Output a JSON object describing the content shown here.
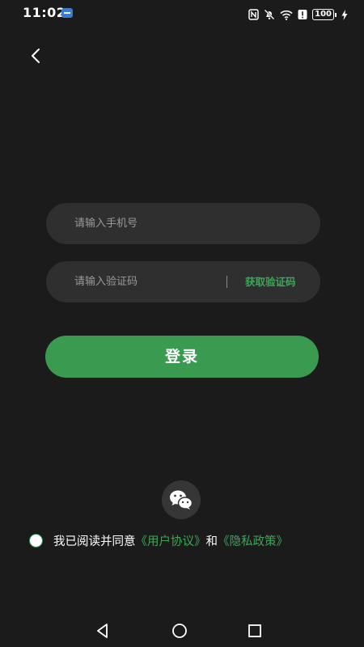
{
  "status": {
    "time": "11:02",
    "battery": "100"
  },
  "login": {
    "phone_placeholder": "请输入手机号",
    "code_placeholder": "请输入验证码",
    "get_code_label": "获取验证码",
    "login_button_label": "登录"
  },
  "agreement": {
    "prefix": "我已阅读并同意",
    "user_agreement": "《用户协议》",
    "and": "和",
    "privacy_policy": "《隐私政策》"
  },
  "colors": {
    "background": "#1b1b1b",
    "field": "#2f2f2f",
    "accent": "#3a9a50",
    "link": "#3fa55a"
  }
}
